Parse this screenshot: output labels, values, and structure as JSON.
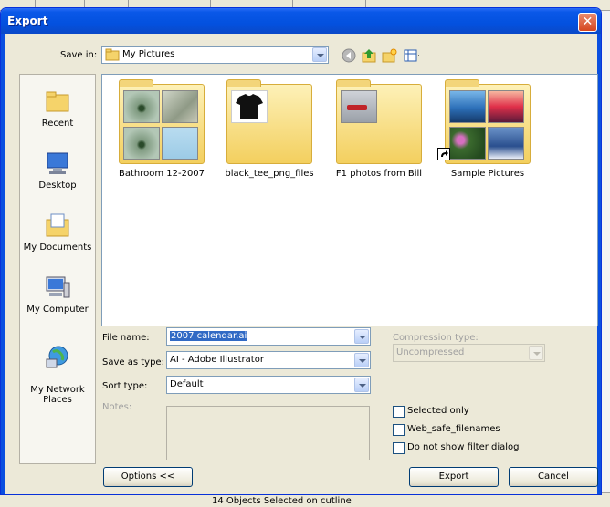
{
  "window": {
    "title": "Export",
    "close_glyph": "✕"
  },
  "toolbar": {
    "save_in_label": "Save in:",
    "save_in_value": "My Pictures",
    "icons": [
      "back-icon",
      "up-folder-icon",
      "new-folder-icon",
      "view-menu-icon"
    ]
  },
  "places": [
    {
      "label": "Recent",
      "icon": "recent-folder-icon"
    },
    {
      "label": "Desktop",
      "icon": "desktop-icon"
    },
    {
      "label": "My Documents",
      "icon": "my-documents-icon"
    },
    {
      "label": "My Computer",
      "icon": "my-computer-icon"
    },
    {
      "label": "My Network\nPlaces",
      "icon": "network-places-icon"
    }
  ],
  "folders": [
    {
      "name": "Bathroom 12-2007"
    },
    {
      "name": "black_tee_png_files"
    },
    {
      "name": "F1 photos from Bill"
    },
    {
      "name": "Sample Pictures"
    }
  ],
  "form": {
    "file_name_label": "File name:",
    "file_name_value": "2007 calendar.ai",
    "save_type_label": "Save as type:",
    "save_type_value": "AI - Adobe Illustrator",
    "sort_type_label": "Sort type:",
    "sort_type_value": "Default",
    "notes_label": "Notes:",
    "compression_label": "Compression type:",
    "compression_value": "Uncompressed"
  },
  "checkboxes": [
    {
      "label": "Selected only",
      "checked": false
    },
    {
      "label": "Web_safe_filenames",
      "checked": false
    },
    {
      "label": "Do not show filter dialog",
      "checked": false
    }
  ],
  "buttons": {
    "options": "Options <<",
    "export": "Export",
    "cancel": "Cancel"
  },
  "statusbar": {
    "text": "14 Objects Selected on cutline"
  },
  "colors": {
    "titlebar": "#0351df",
    "selection": "#316ac5",
    "close_button": "#d6461f"
  }
}
